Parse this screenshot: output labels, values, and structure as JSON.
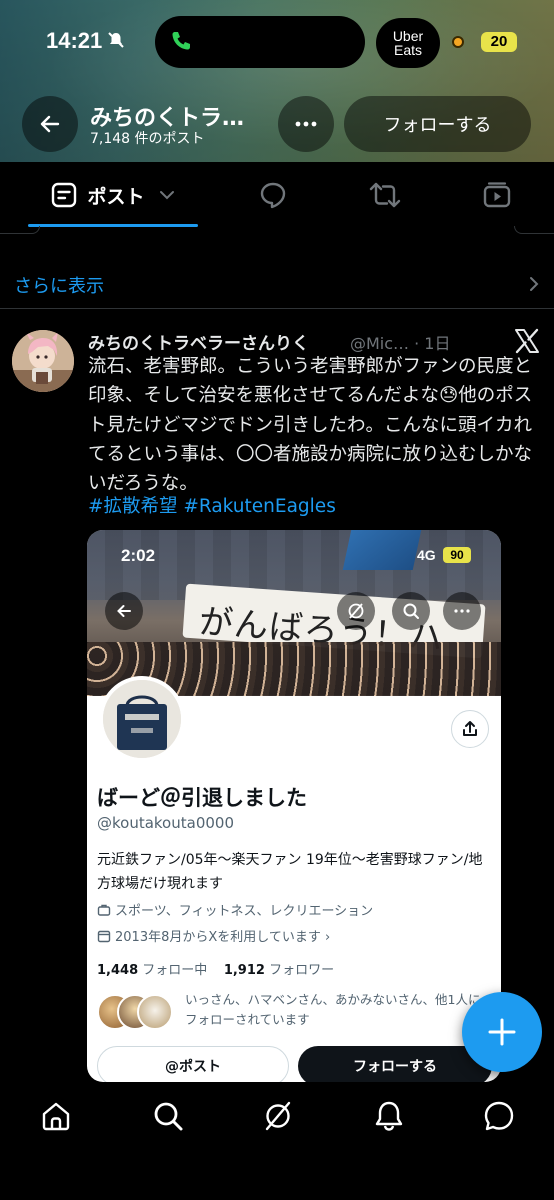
{
  "status_bar": {
    "time": "14:21",
    "uber_line1": "Uber",
    "uber_line2": "Eats",
    "battery": "20"
  },
  "header": {
    "name": "みちのくトラ…",
    "post_count": "7,148 件のポスト",
    "follow_label": "フォローする"
  },
  "tabs": {
    "post_label": "ポスト"
  },
  "show_more": "さらに表示",
  "post": {
    "display_name": "みちのくトラベラーさんりく",
    "handle_time": "@Mic… · 1日",
    "text": "流石、老害野郎。こういう老害野郎がファンの民度と印象、そして治安を悪化させてるんだよな😓他のポスト見たけどマジでドン引きしたわ。こんなに頭イカれてるという事は、〇〇者施設か病院に放り込むしかないだろうな。",
    "hashtags": "#拡散希望 #RakutenEagles"
  },
  "card": {
    "status_time": "2:02",
    "network": "4G",
    "battery": "90",
    "banner_text": "がんばろう！ハ",
    "profile_name": "ばーど＠引退しました",
    "profile_handle": "@koutakouta0000",
    "bio": "元近鉄ファン/05年〜楽天ファン 19年位〜老害野球ファン/地方球場だけ現れます",
    "category": "スポーツ、フィットネス、レクリエーション",
    "joined": "2013年8月からXを利用しています ›",
    "following_count": "1,448",
    "following_label": "フォロー中",
    "followers_count": "1,912",
    "followers_label": "フォロワー",
    "followed_by": "いっさん、ハマベンさん、あかみないさん、他1人にフォローされています",
    "post_button": "@ポスト",
    "follow_button": "フォローする"
  },
  "colors": {
    "accent": "#1d9bf0",
    "background": "#000000",
    "muted": "#71767b"
  },
  "icons": [
    "back-arrow-icon",
    "more-dots-icon",
    "post-list-icon",
    "chevron-down-icon",
    "reply-icon",
    "repost-icon",
    "video-icon",
    "x-logo-icon",
    "compose-plus-icon",
    "home-icon",
    "search-icon",
    "grok-icon",
    "bell-icon",
    "messages-icon"
  ]
}
